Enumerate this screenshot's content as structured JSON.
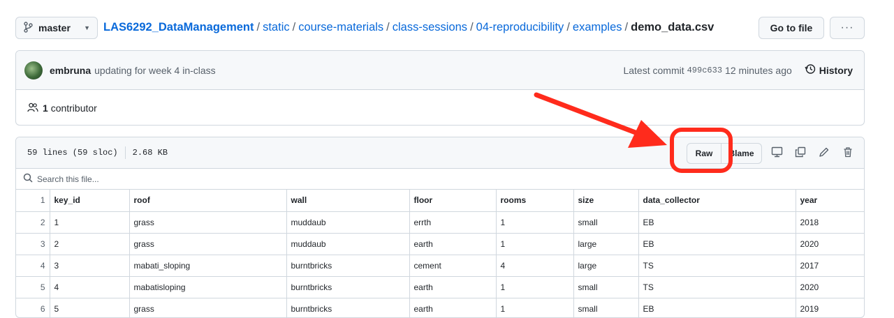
{
  "branch": {
    "label": "master"
  },
  "breadcrumb": {
    "repo": "LAS6292_DataManagement",
    "path": [
      "static",
      "course-materials",
      "class-sessions",
      "04-reproducibility",
      "examples"
    ],
    "file": "demo_data.csv"
  },
  "actions": {
    "goto_label": "Go to file",
    "more_label": "···"
  },
  "commit": {
    "author": "embruna",
    "message": "updating for week 4 in-class",
    "latest_label": "Latest commit",
    "sha": "499c633",
    "time": "12 minutes ago",
    "history_label": "History"
  },
  "contributors": {
    "count": "1",
    "label": "contributor"
  },
  "file": {
    "lines": "59 lines (59 sloc)",
    "size": "2.68 KB",
    "raw_label": "Raw",
    "blame_label": "Blame",
    "search_placeholder": "Search this file..."
  },
  "table": {
    "headers": [
      "key_id",
      "roof",
      "wall",
      "floor",
      "rooms",
      "size",
      "data_collector",
      "year"
    ],
    "rows": [
      {
        "ln": "2",
        "cells": [
          "1",
          "grass",
          "muddaub",
          "errth",
          "1",
          "small",
          "EB",
          "2018"
        ]
      },
      {
        "ln": "3",
        "cells": [
          "2",
          "grass",
          "muddaub",
          "earth",
          "1",
          "large",
          "EB",
          "2020"
        ]
      },
      {
        "ln": "4",
        "cells": [
          "3",
          "mabati_sloping",
          "burntbricks",
          "cement",
          "4",
          "large",
          "TS",
          "2017"
        ]
      },
      {
        "ln": "5",
        "cells": [
          "4",
          "mabatisloping",
          "burntbricks",
          "earth",
          "1",
          "small",
          "TS",
          "2020"
        ]
      },
      {
        "ln": "6",
        "cells": [
          "5",
          "grass",
          "burntbricks",
          "earth",
          "1",
          "small",
          "EB",
          "2019"
        ]
      }
    ]
  },
  "colors": {
    "link": "#0969da",
    "annotation": "#ff2b1c"
  },
  "icons": [
    "branch-icon",
    "kebab-icon",
    "history-icon",
    "people-icon",
    "search-icon",
    "display-icon",
    "copy-icon",
    "pencil-icon",
    "trash-icon",
    "arrow-annotation"
  ]
}
